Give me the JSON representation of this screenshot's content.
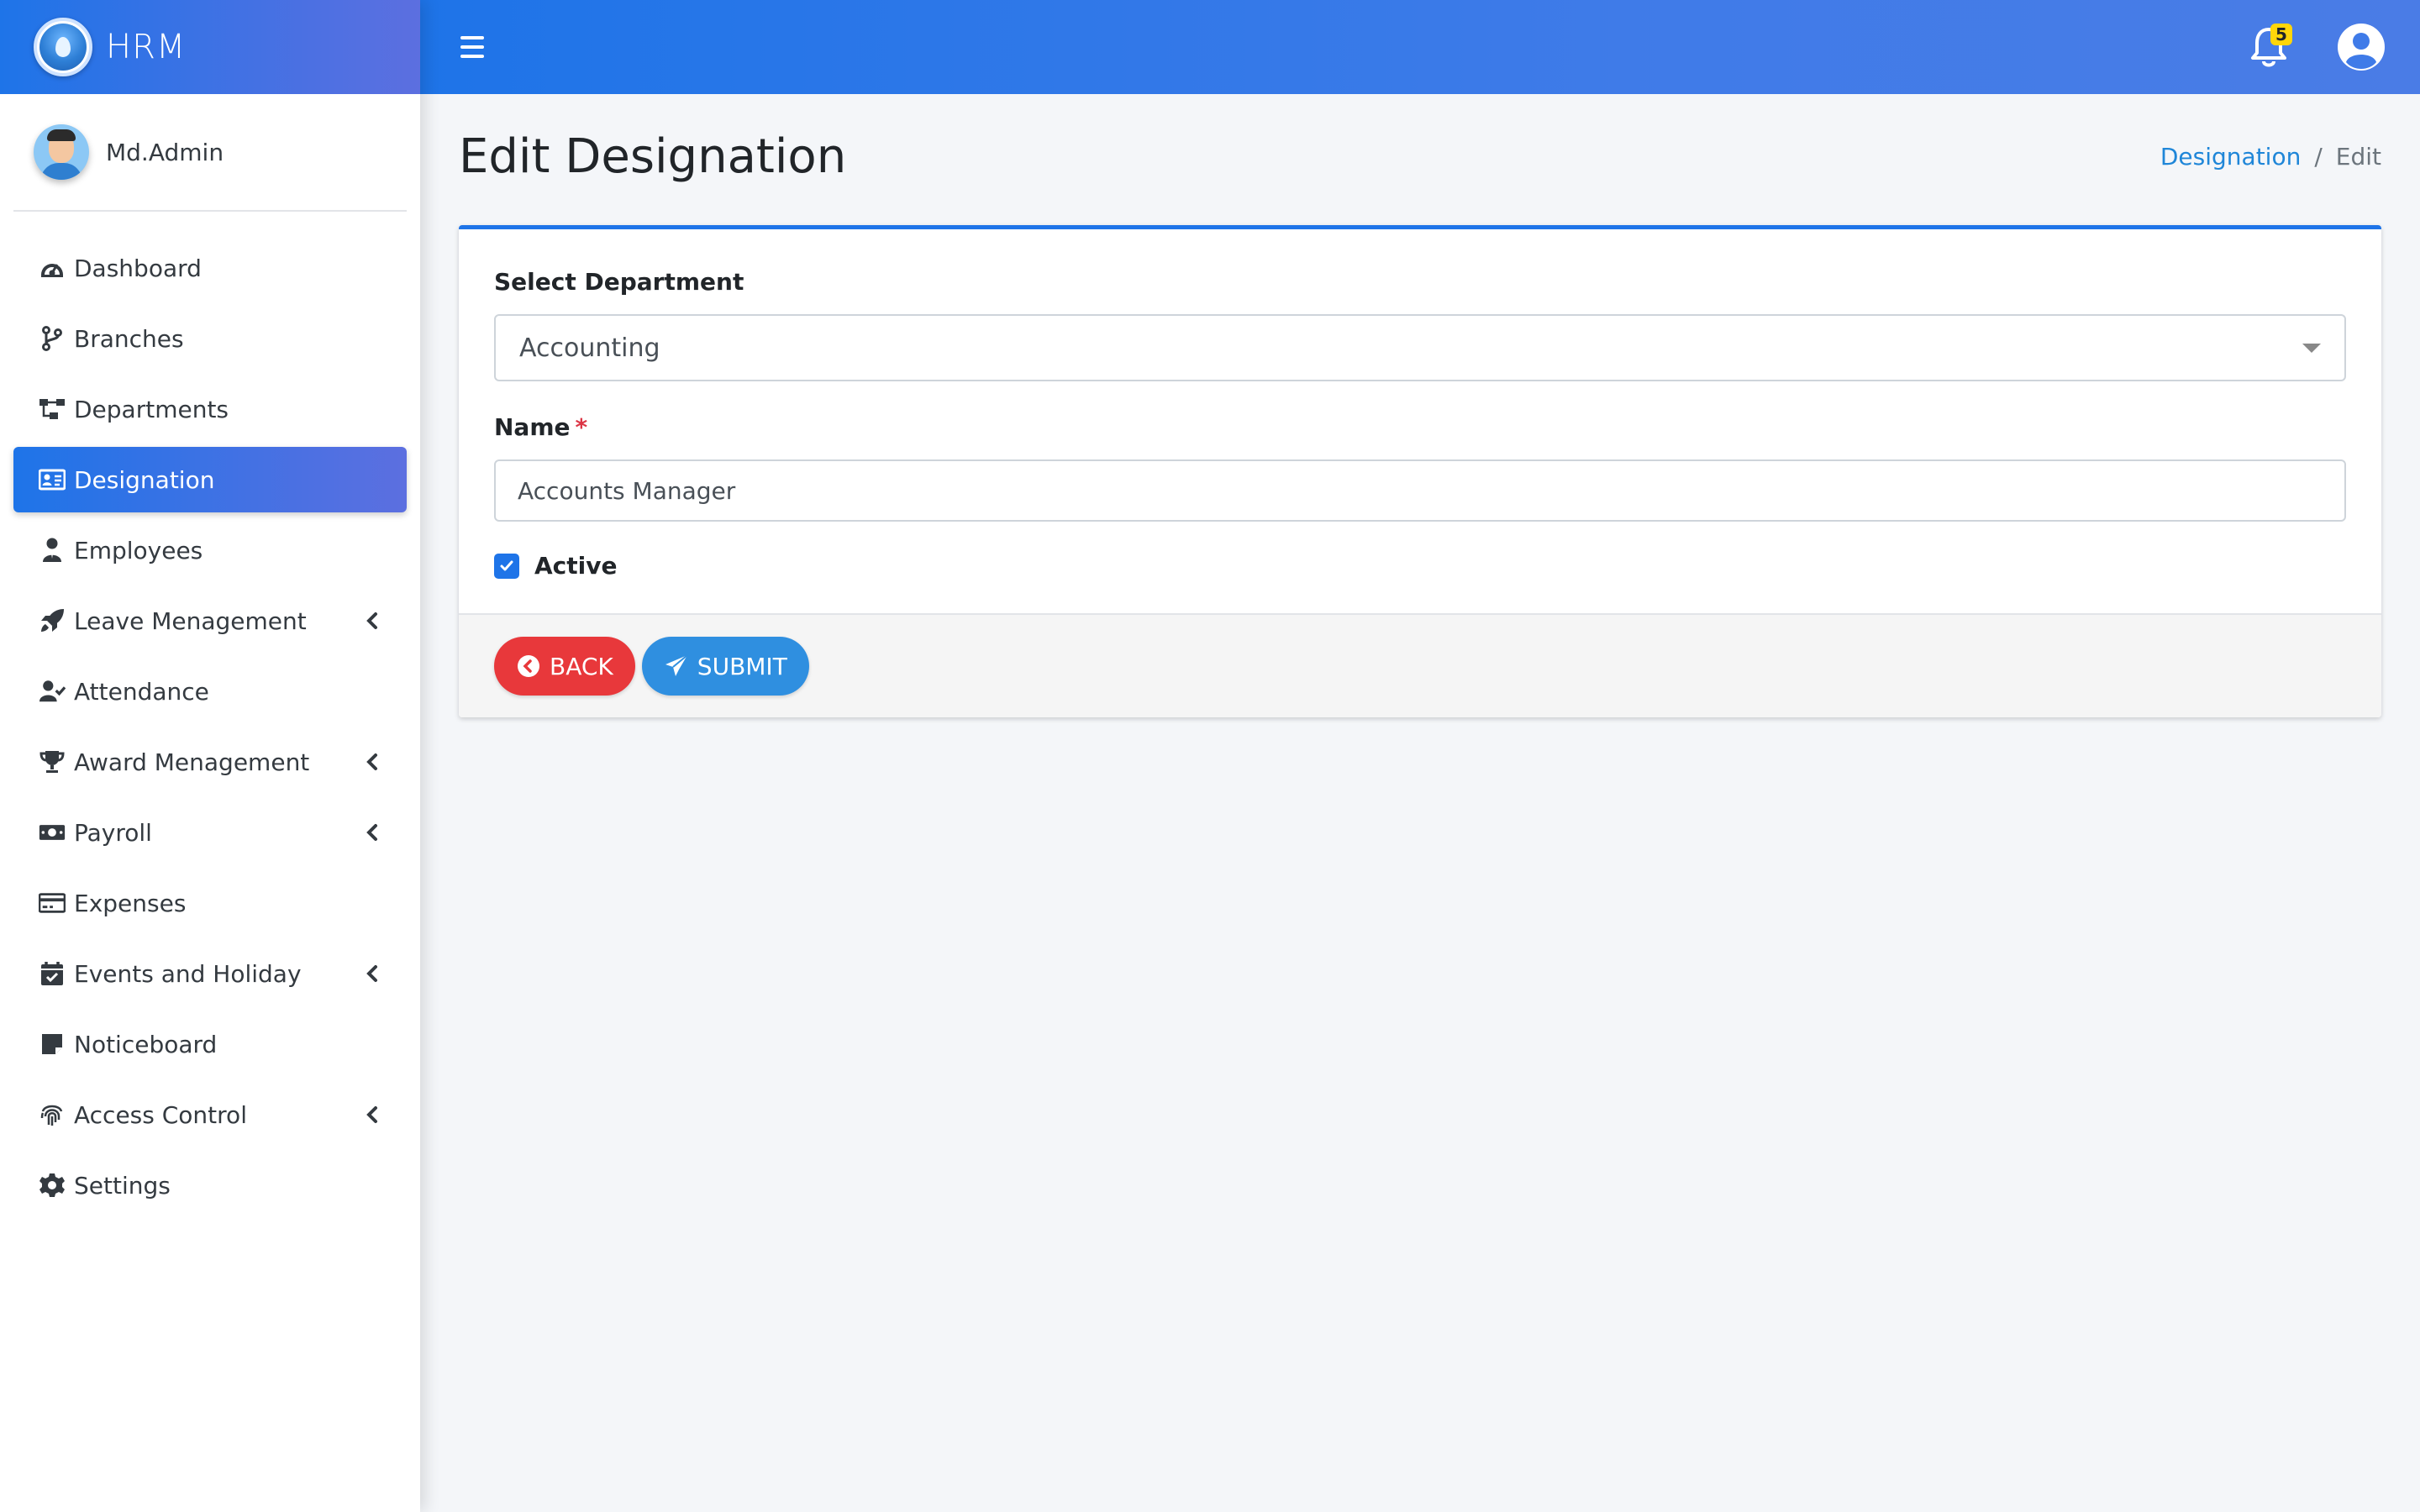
{
  "brand": {
    "name": "HRM"
  },
  "user": {
    "name": "Md.Admin"
  },
  "sidebar": {
    "items": [
      {
        "label": "Dashboard",
        "icon": "dashboard-icon",
        "active": false,
        "chevron": false
      },
      {
        "label": "Branches",
        "icon": "branch-icon",
        "active": false,
        "chevron": false
      },
      {
        "label": "Departments",
        "icon": "sitemap-icon",
        "active": false,
        "chevron": false
      },
      {
        "label": "Designation",
        "icon": "id-card-icon",
        "active": true,
        "chevron": false
      },
      {
        "label": "Employees",
        "icon": "user-tie-icon",
        "active": false,
        "chevron": false
      },
      {
        "label": "Leave Menagement",
        "icon": "rocket-icon",
        "active": false,
        "chevron": true
      },
      {
        "label": "Attendance",
        "icon": "user-check-icon",
        "active": false,
        "chevron": false
      },
      {
        "label": "Award Menagement",
        "icon": "trophy-icon",
        "active": false,
        "chevron": true
      },
      {
        "label": "Payroll",
        "icon": "money-bill-icon",
        "active": false,
        "chevron": true
      },
      {
        "label": "Expenses",
        "icon": "credit-card-icon",
        "active": false,
        "chevron": false
      },
      {
        "label": "Events and Holiday",
        "icon": "calendar-check-icon",
        "active": false,
        "chevron": true
      },
      {
        "label": "Noticeboard",
        "icon": "sticky-note-icon",
        "active": false,
        "chevron": false
      },
      {
        "label": "Access Control",
        "icon": "fingerprint-icon",
        "active": false,
        "chevron": true
      },
      {
        "label": "Settings",
        "icon": "gear-icon",
        "active": false,
        "chevron": false
      }
    ]
  },
  "topbar": {
    "notification_count": "5"
  },
  "page": {
    "title": "Edit Designation",
    "breadcrumb": {
      "parent": "Designation",
      "separator": "/",
      "current": "Edit"
    }
  },
  "form": {
    "department_label": "Select Department",
    "department_value": "Accounting",
    "name_label": "Name",
    "name_required_mark": "*",
    "name_value": "Accounts Manager",
    "active_label": "Active",
    "active_checked": true
  },
  "buttons": {
    "back": "BACK",
    "submit": "SUBMIT"
  },
  "colors": {
    "primary": "#1e74e8",
    "gradient_end": "#5c6fe0",
    "danger": "#e8383b",
    "info": "#2f8fe0",
    "badge": "#ffd60a"
  }
}
